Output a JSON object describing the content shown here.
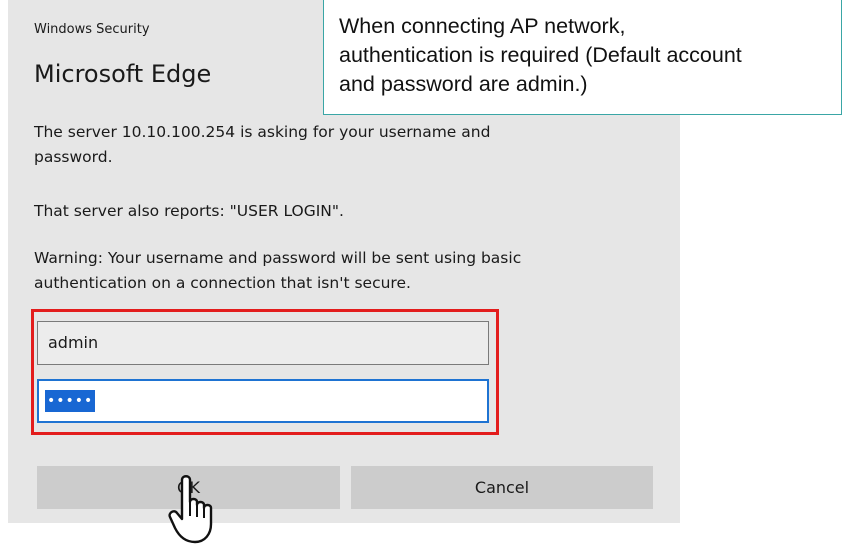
{
  "dialog": {
    "app_label": "Windows Security",
    "title": "Microsoft Edge",
    "message_lines": [
      "The server 10.10.100.254 is asking for your username and",
      "password."
    ],
    "server_report": "That server also reports: \"USER LOGIN\".",
    "warning_lines": [
      "Warning: Your username and password will be sent using basic",
      "authentication on a connection that isn't secure."
    ],
    "username_value": "admin",
    "password_value": "•••••",
    "ok_label": "OK",
    "cancel_label": "Cancel"
  },
  "callout": {
    "lines": [
      "When connecting AP network,",
      "authentication is required (Default account",
      "and password are admin.)"
    ],
    "border_color": "#3aa6a6"
  },
  "colors": {
    "highlight": "#e31d1d",
    "focus_border": "#1e73d2",
    "selection": "#1867d3",
    "dialog_bg": "#e6e6e6",
    "button_bg": "#cccccc"
  },
  "icons": {
    "cursor": "hand-pointer-icon"
  }
}
